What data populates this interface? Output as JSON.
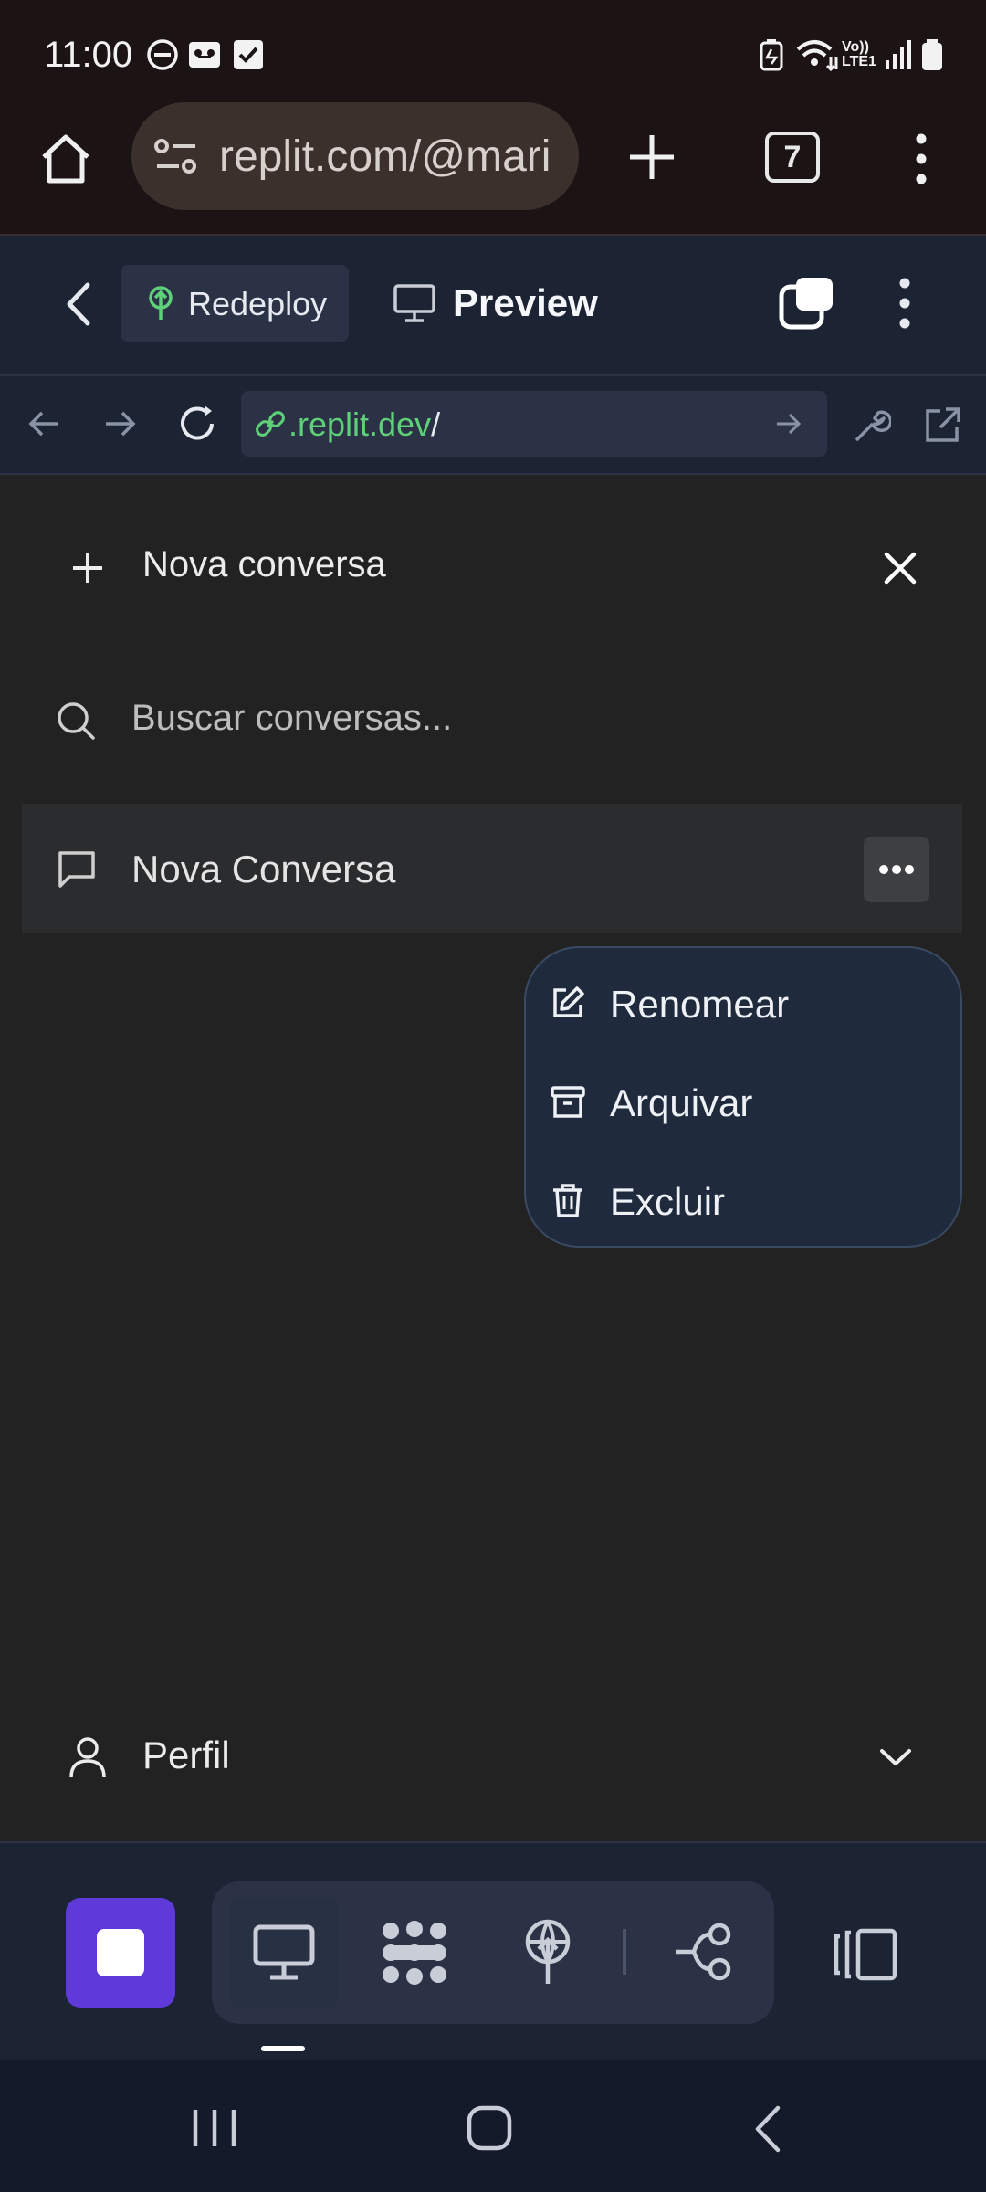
{
  "status_bar": {
    "time": "11:00",
    "icons": [
      "do-not-disturb-icon",
      "voicemail-icon",
      "checkbox-icon",
      "battery-saver-icon",
      "wifi-icon",
      "volte-icon",
      "signal-icon",
      "battery-icon"
    ],
    "volte_text": "Vo)) LTE1"
  },
  "browser": {
    "url": "replit.com/@mari",
    "tab_count": "7"
  },
  "replit_header": {
    "redeploy_label": "Redeploy",
    "preview_label": "Preview"
  },
  "webview": {
    "url_domain": ".replit.dev",
    "url_path": "/"
  },
  "sidebar": {
    "new_conversation_label": "Nova conversa",
    "search_placeholder": "Buscar conversas...",
    "conversations": [
      {
        "label": "Nova Conversa"
      }
    ],
    "profile_label": "Perfil"
  },
  "context_menu": {
    "items": [
      {
        "label": "Renomear",
        "icon": "edit-icon"
      },
      {
        "label": "Arquivar",
        "icon": "archive-icon"
      },
      {
        "label": "Excluir",
        "icon": "trash-icon"
      }
    ]
  },
  "colors": {
    "replit_header_bg": "#1c2333",
    "accent_purple": "#5f3ad9",
    "url_green": "#5fd07a",
    "menu_bg": "#1f2a3c"
  }
}
